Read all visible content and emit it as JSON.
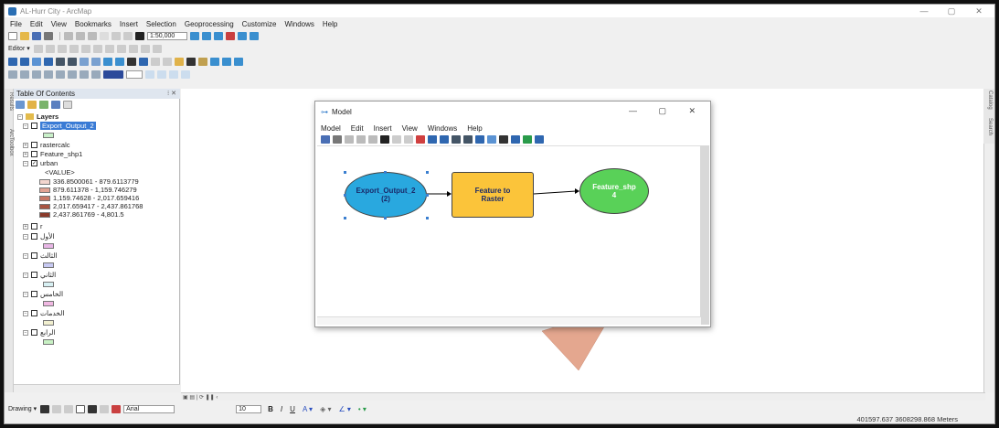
{
  "app": {
    "title": "AL-Hurr City - ArcMap"
  },
  "menu": [
    "File",
    "Edit",
    "View",
    "Bookmarks",
    "Insert",
    "Selection",
    "Geoprocessing",
    "Customize",
    "Windows",
    "Help"
  ],
  "toolbar": {
    "scale": "1:50,000",
    "editor_label": "Editor ▾"
  },
  "toc": {
    "title": "Table Of Contents",
    "side_tabs": [
      "Results",
      "ArcToolbox"
    ],
    "right_tabs": [
      "Catalog",
      "Search"
    ],
    "layers_label": "Layers",
    "layers": [
      {
        "name": "Export_Output_2",
        "checked": false,
        "selected": true,
        "swatch": "#c9f0c9"
      },
      {
        "name": "rastercalc",
        "checked": false
      },
      {
        "name": "Feature_shp1",
        "checked": false
      },
      {
        "name": "urban",
        "checked": true
      }
    ],
    "urban_value_label": "<VALUE>",
    "urban_legend": [
      {
        "label": "336.8500061 - 879.6113779",
        "color": "#f3d6cf"
      },
      {
        "label": "879.611378 - 1,159.746279",
        "color": "#e2a393"
      },
      {
        "label": "1,159.74628 - 2,017.659416",
        "color": "#c87765"
      },
      {
        "label": "2,017.659417 - 2,437.861768",
        "color": "#a85441"
      },
      {
        "label": "2,437.861769 - 4,801.5",
        "color": "#8a3a2a"
      }
    ],
    "extra_layers": [
      {
        "name": "r",
        "swatch": null
      },
      {
        "name": "الأول",
        "swatch": "#e8b6e6"
      },
      {
        "name": "الثالث",
        "swatch": "#c7c9f2"
      },
      {
        "name": "الثاني",
        "swatch": "#d7f0f3"
      },
      {
        "name": "الخامس",
        "swatch": "#f0b8e2"
      },
      {
        "name": "الخدمات",
        "swatch": "#f1efcf"
      },
      {
        "name": "الرابع",
        "swatch": "#c8f1c4"
      }
    ]
  },
  "model": {
    "title": "Model",
    "menu": [
      "Model",
      "Edit",
      "Insert",
      "View",
      "Windows",
      "Help"
    ],
    "nodes": {
      "input": "Export_Output_2 (2)",
      "tool": "Feature to Raster",
      "output": "Feature_shp 4"
    },
    "colors": {
      "input": "#29a8df",
      "tool": "#fbc43a",
      "output": "#59d158"
    }
  },
  "drawing": {
    "label": "Drawing ▾",
    "font": "Arial",
    "size": "10"
  },
  "status": {
    "coords": "401597.637  3608298.868 Meters"
  }
}
